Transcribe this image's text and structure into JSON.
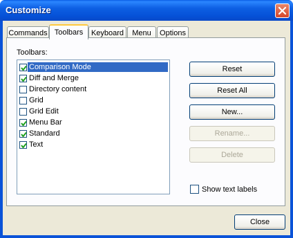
{
  "window": {
    "title": "Customize"
  },
  "tabs": [
    {
      "label": "Commands"
    },
    {
      "label": "Toolbars"
    },
    {
      "label": "Keyboard"
    },
    {
      "label": "Menu"
    },
    {
      "label": "Options"
    }
  ],
  "active_tab": "Toolbars",
  "toolbars": {
    "label": "Toolbars:",
    "items": [
      {
        "label": "Comparison Mode",
        "checked": true,
        "selected": true
      },
      {
        "label": "Diff and Merge",
        "checked": true,
        "selected": false
      },
      {
        "label": "Directory content",
        "checked": false,
        "selected": false
      },
      {
        "label": "Grid",
        "checked": false,
        "selected": false
      },
      {
        "label": "Grid Edit",
        "checked": false,
        "selected": false
      },
      {
        "label": "Menu Bar",
        "checked": true,
        "selected": false
      },
      {
        "label": "Standard",
        "checked": true,
        "selected": false
      },
      {
        "label": "Text",
        "checked": true,
        "selected": false
      }
    ]
  },
  "buttons": {
    "reset": "Reset",
    "reset_all": "Reset All",
    "new": "New...",
    "rename": "Rename...",
    "delete": "Delete",
    "close": "Close"
  },
  "show_text_labels": {
    "label": "Show text labels",
    "checked": false
  },
  "colors": {
    "titlebar": "#0a53d8",
    "selection": "#316ac5",
    "dialog_bg": "#ece9d8",
    "active_tab_accent": "#ffc83c"
  }
}
